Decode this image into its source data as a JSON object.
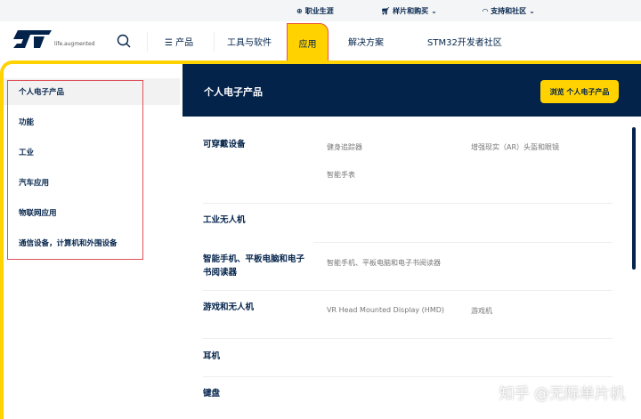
{
  "topbar": {
    "careers": "职业生涯",
    "buy": "样片和购买",
    "support": "支持和社区"
  },
  "nav": {
    "tagline": "life.augmented",
    "products": "产品",
    "tools": "工具与软件",
    "applications": "应用",
    "solutions": "解决方案",
    "stm32": "STM32开发者社区"
  },
  "sidebar": {
    "items": [
      {
        "label": "个人电子产品"
      },
      {
        "label": "功能"
      },
      {
        "label": "工业"
      },
      {
        "label": "汽车应用"
      },
      {
        "label": "物联网应用"
      },
      {
        "label": "通信设备，计算机和外围设备"
      }
    ]
  },
  "panel": {
    "title": "个人电子产品",
    "browse": "浏览 个人电子产品",
    "sections": [
      {
        "title": "可穿戴设备",
        "links": [
          "健身追踪器",
          "增强现实（AR）头盔和眼镜",
          "智能手表"
        ]
      },
      {
        "title": "工业无人机",
        "links": []
      },
      {
        "title": "智能手机、平板电脑和电子书阅读器",
        "links": [
          "智能手机、平板电脑和电子书阅读器"
        ]
      },
      {
        "title": "游戏和无人机",
        "links": [
          "VR Head Mounted Display (HMD)",
          "游戏机"
        ]
      },
      {
        "title": "耳机",
        "links": []
      },
      {
        "title": "键盘",
        "links": []
      }
    ]
  },
  "watermark": "知乎 @无际单片机",
  "colors": {
    "brand": "#03234b",
    "accent": "#ffd200",
    "annotation": "#e0505a"
  }
}
